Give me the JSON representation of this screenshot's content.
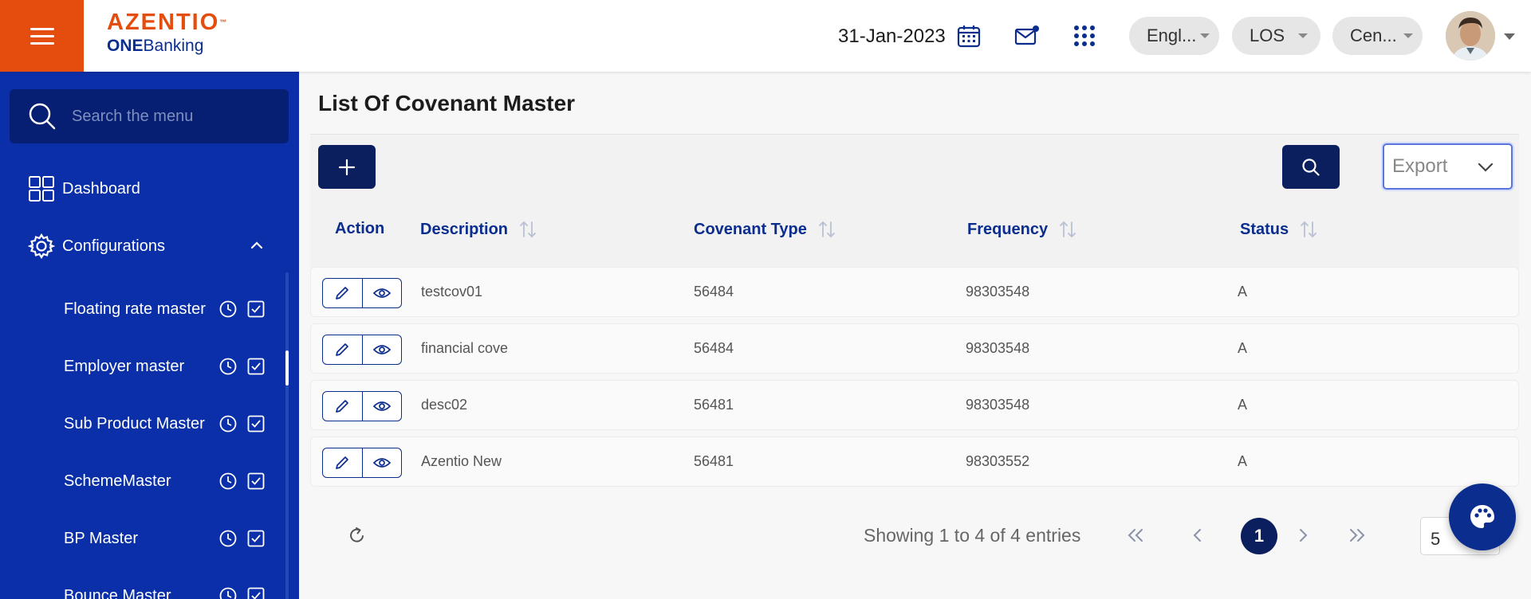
{
  "header": {
    "logo_text": "AZENTIO",
    "logo_sub_bold": "ONE",
    "logo_sub_rest": "Banking",
    "date": "31-Jan-2023",
    "language_label": "Engl...",
    "module_label": "LOS",
    "branch_label": "Cen..."
  },
  "sidebar": {
    "search_placeholder": "Search the menu",
    "dashboard_label": "Dashboard",
    "configurations_label": "Configurations",
    "items": [
      {
        "label": "Floating rate master"
      },
      {
        "label": "Employer master"
      },
      {
        "label": "Sub Product Master"
      },
      {
        "label": "SchemeMaster"
      },
      {
        "label": "BP Master"
      },
      {
        "label": "Bounce Master"
      }
    ]
  },
  "main": {
    "title": "List Of Covenant Master",
    "export_label": "Export",
    "columns": {
      "action": "Action",
      "description": "Description",
      "covenant_type": "Covenant Type",
      "frequency": "Frequency",
      "status": "Status"
    },
    "rows": [
      {
        "description": "testcov01",
        "covenant_type": "56484",
        "frequency": "98303548",
        "status": "A"
      },
      {
        "description": "financial cove",
        "covenant_type": "56484",
        "frequency": "98303548",
        "status": "A"
      },
      {
        "description": "desc02",
        "covenant_type": "56481",
        "frequency": "98303548",
        "status": "A"
      },
      {
        "description": "Azentio New",
        "covenant_type": "56481",
        "frequency": "98303552",
        "status": "A"
      }
    ],
    "pagination": {
      "showing_text": "Showing 1 to 4 of 4 entries",
      "current_page": "1",
      "page_size": "5"
    }
  },
  "colors": {
    "brand_orange": "#e44d0e",
    "sidebar_blue": "#0a2fa8",
    "primary_navy": "#0b1f5e",
    "link_blue": "#0a2d8e"
  }
}
